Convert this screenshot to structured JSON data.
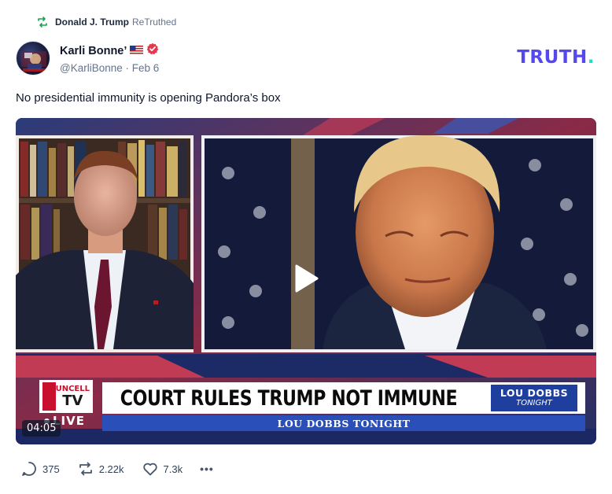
{
  "retruth": {
    "name": "Donald J. Trump",
    "suffix": "ReTruthed",
    "icon": "retruth-icon"
  },
  "author": {
    "display_name": "Karli Bonne’",
    "handle": "@KarliBonne",
    "separator": "·",
    "date": "Feb 6",
    "flag_icon": "us-flag-icon",
    "verified_icon": "verified-badge-icon",
    "avatar": "avatar"
  },
  "brand": {
    "name": "TRUTH",
    "dot": ".",
    "color": "#5448ee",
    "dot_color": "#17e1c4"
  },
  "post": {
    "text": "No presidential immunity is opening Pandora’s box"
  },
  "video": {
    "duration": "04:05",
    "play_icon": "play-icon",
    "headline": "COURT RULES TRUMP NOT IMMUNE",
    "show_name": "LOU DOBBS TONIGHT",
    "show_logo_line1": "LOU DOBBS",
    "show_logo_line2": "TONIGHT",
    "network_label": "UNCELL",
    "network_tv": "TV",
    "live_label": "LIVE"
  },
  "actions": {
    "replies": {
      "icon": "comment-icon",
      "count": "375"
    },
    "retruths": {
      "icon": "retruth-icon",
      "count": "2.22k"
    },
    "likes": {
      "icon": "heart-icon",
      "count": "7.3k"
    },
    "more": {
      "icon": "more-icon",
      "label": "•••"
    }
  }
}
